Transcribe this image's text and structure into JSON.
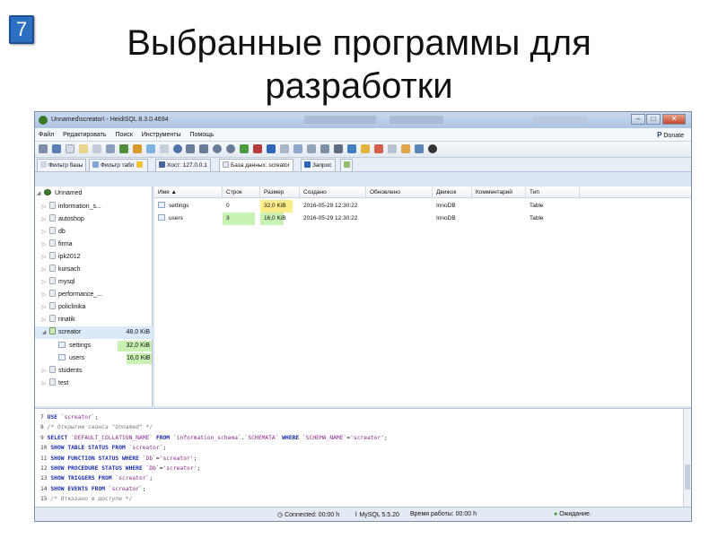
{
  "slide": {
    "number": "7",
    "title_line1": "Выбранные программы для",
    "title_line2": "разработки"
  },
  "window": {
    "title": "Unnamed\\screator\\ - HeidiSQL 8.3.0.4694",
    "controls": [
      "–",
      "□",
      "✕"
    ]
  },
  "menu": {
    "items": [
      "Файл",
      "Редактировать",
      "Поиск",
      "Инструменты",
      "Помощь"
    ],
    "donate": "Donate"
  },
  "tabs": {
    "filter1": "Фильтр базы",
    "filter2": "Фильтр табл",
    "host": "Хост: 127.0.0.1",
    "database": "База данных: screator",
    "query": "Запрос"
  },
  "tree": {
    "root": "Unnamed",
    "databases": [
      "information_s...",
      "autoshop",
      "db",
      "firma",
      "ipk2012",
      "kursach",
      "mysql",
      "performance_...",
      "policlinika",
      "rinatik"
    ],
    "selected": {
      "name": "screator",
      "size": "48,0 KiB"
    },
    "tables": [
      {
        "name": "settings",
        "size": "32,0 KiB"
      },
      {
        "name": "users",
        "size": "16,0 KiB"
      }
    ],
    "after": [
      "students",
      "test"
    ]
  },
  "grid": {
    "columns": [
      "Имя",
      "Строк",
      "Размер",
      "Создано",
      "Обновлено",
      "Движок",
      "Комментарий",
      "Тип"
    ],
    "rows": [
      {
        "name": "settings",
        "rows": "0",
        "size": "32,0 KiB",
        "created": "2016-05-29 12:30:22",
        "updated": "",
        "engine": "InnoDB",
        "comment": "",
        "type": "Table"
      },
      {
        "name": "users",
        "rows": "3",
        "size": "16,0 KiB",
        "created": "2016-05-29 12:30:22",
        "updated": "",
        "engine": "InnoDB",
        "comment": "",
        "type": "Table"
      }
    ]
  },
  "sql_log": [
    {
      "n": "7",
      "parts": [
        [
          "kw",
          "USE"
        ],
        [
          "t",
          " "
        ],
        [
          "st",
          "`screator`"
        ],
        [
          "t",
          ";"
        ]
      ]
    },
    {
      "n": "8",
      "parts": [
        [
          "cm",
          "/* Открытие сеанса \"Unnamed\" */"
        ]
      ]
    },
    {
      "n": "9",
      "parts": [
        [
          "kw",
          "SELECT"
        ],
        [
          "t",
          " "
        ],
        [
          "st",
          "`DEFAULT_COLLATION_NAME`"
        ],
        [
          "t",
          " "
        ],
        [
          "kw",
          "FROM"
        ],
        [
          "t",
          " "
        ],
        [
          "st",
          "`information_schema`"
        ],
        [
          "t",
          "."
        ],
        [
          "st",
          "`SCHEMATA`"
        ],
        [
          "t",
          " "
        ],
        [
          "kw",
          "WHERE"
        ],
        [
          "t",
          " "
        ],
        [
          "st",
          "`SCHEMA_NAME`"
        ],
        [
          "t",
          "="
        ],
        [
          "st",
          "'screator'"
        ],
        [
          "t",
          ";"
        ]
      ]
    },
    {
      "n": "10",
      "parts": [
        [
          "kw",
          "SHOW TABLE STATUS FROM"
        ],
        [
          "t",
          " "
        ],
        [
          "st",
          "`screator`"
        ],
        [
          "t",
          ";"
        ]
      ]
    },
    {
      "n": "11",
      "parts": [
        [
          "kw",
          "SHOW FUNCTION STATUS WHERE"
        ],
        [
          "t",
          " "
        ],
        [
          "st",
          "`Db`"
        ],
        [
          "t",
          "="
        ],
        [
          "st",
          "'screator'"
        ],
        [
          "t",
          ";"
        ]
      ]
    },
    {
      "n": "12",
      "parts": [
        [
          "kw",
          "SHOW PROCEDURE STATUS WHERE"
        ],
        [
          "t",
          " "
        ],
        [
          "st",
          "`Db`"
        ],
        [
          "t",
          "="
        ],
        [
          "st",
          "'screator'"
        ],
        [
          "t",
          ";"
        ]
      ]
    },
    {
      "n": "13",
      "parts": [
        [
          "kw",
          "SHOW TRIGGERS FROM"
        ],
        [
          "t",
          " "
        ],
        [
          "st",
          "`screator`"
        ],
        [
          "t",
          ";"
        ]
      ]
    },
    {
      "n": "14",
      "parts": [
        [
          "kw",
          "SHOW EVENTS FROM"
        ],
        [
          "t",
          " "
        ],
        [
          "st",
          "`screator`"
        ],
        [
          "t",
          ";"
        ]
      ]
    },
    {
      "n": "15",
      "parts": [
        [
          "cm",
          "/* Отказано в доступе */"
        ]
      ]
    }
  ],
  "status": {
    "connected": "Connected: 00:00 h",
    "server": "MySQL 5.5.20",
    "uptime": "Время работы: 00:00 h",
    "state": "Ожидание."
  },
  "colors": {
    "green_cell": "#c9f1b4",
    "yellow_cell": "#fbee8a",
    "keyword": "#1a2da8"
  }
}
